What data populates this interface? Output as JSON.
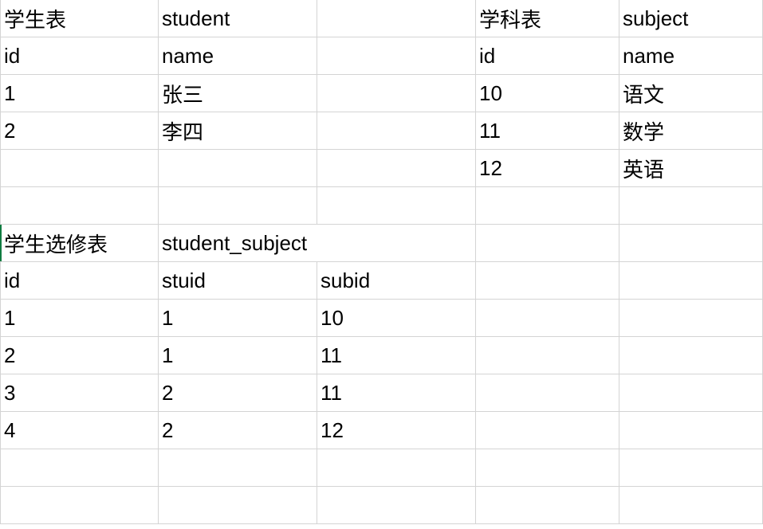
{
  "grid": {
    "row0": {
      "c0": "学生表",
      "c1": "student",
      "c2": "",
      "c3": "学科表",
      "c4": "subject"
    },
    "row1": {
      "c0": "id",
      "c1": "name",
      "c2": "",
      "c3": "id",
      "c4": "name"
    },
    "row2": {
      "c0": "1",
      "c1": "张三",
      "c2": "",
      "c3": "10",
      "c4": "语文"
    },
    "row3": {
      "c0": "2",
      "c1": "李四",
      "c2": "",
      "c3": "11",
      "c4": "数学"
    },
    "row4": {
      "c0": "",
      "c1": "",
      "c2": "",
      "c3": "12",
      "c4": "英语"
    },
    "row5": {
      "c0": "",
      "c1": "",
      "c2": "",
      "c3": "",
      "c4": ""
    },
    "row6": {
      "c0": "学生选修表",
      "c1": "student_subject",
      "c2": "",
      "c3": "",
      "c4": ""
    },
    "row7": {
      "c0": "id",
      "c1": "stuid",
      "c2": "subid",
      "c3": "",
      "c4": ""
    },
    "row8": {
      "c0": "1",
      "c1": "1",
      "c2": "10",
      "c3": "",
      "c4": ""
    },
    "row9": {
      "c0": "2",
      "c1": "1",
      "c2": "11",
      "c3": "",
      "c4": ""
    },
    "row10": {
      "c0": "3",
      "c1": "2",
      "c2": "11",
      "c3": "",
      "c4": ""
    },
    "row11": {
      "c0": "4",
      "c1": "2",
      "c2": "12",
      "c3": "",
      "c4": ""
    },
    "row12": {
      "c0": "",
      "c1": "",
      "c2": "",
      "c3": "",
      "c4": ""
    },
    "row13": {
      "c0": "",
      "c1": "",
      "c2": "",
      "c3": "",
      "c4": ""
    }
  },
  "chart_data": {
    "type": "table",
    "tables": [
      {
        "title_cn": "学生表",
        "title_en": "student",
        "columns": [
          "id",
          "name"
        ],
        "rows": [
          [
            "1",
            "张三"
          ],
          [
            "2",
            "李四"
          ]
        ]
      },
      {
        "title_cn": "学科表",
        "title_en": "subject",
        "columns": [
          "id",
          "name"
        ],
        "rows": [
          [
            "10",
            "语文"
          ],
          [
            "11",
            "数学"
          ],
          [
            "12",
            "英语"
          ]
        ]
      },
      {
        "title_cn": "学生选修表",
        "title_en": "student_subject",
        "columns": [
          "id",
          "stuid",
          "subid"
        ],
        "rows": [
          [
            "1",
            "1",
            "10"
          ],
          [
            "2",
            "1",
            "11"
          ],
          [
            "3",
            "2",
            "11"
          ],
          [
            "4",
            "2",
            "12"
          ]
        ]
      }
    ]
  }
}
